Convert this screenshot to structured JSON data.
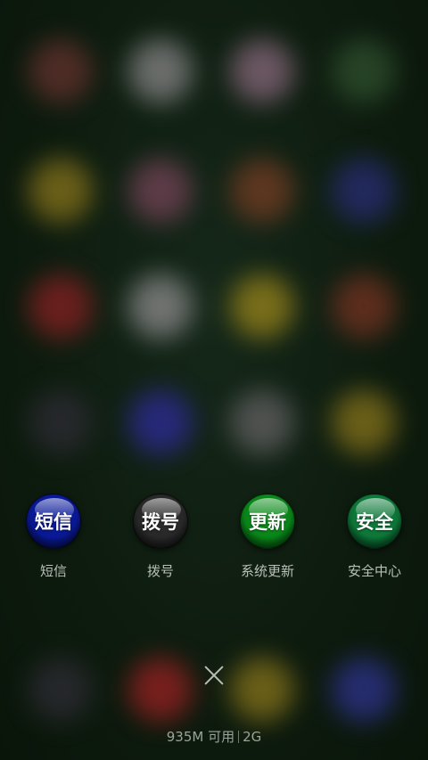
{
  "background_icons": [
    {
      "color": "#5a2f2a"
    },
    {
      "color": "#7a7a7a"
    },
    {
      "color": "#7a6070"
    },
    {
      "color": "#2b4a2b"
    },
    {
      "color": "#7a6a1a"
    },
    {
      "color": "#6a4050"
    },
    {
      "color": "#6a3a22"
    },
    {
      "color": "#252b6a"
    },
    {
      "color": "#7a2020"
    },
    {
      "color": "#808080"
    },
    {
      "color": "#8a7a1a"
    },
    {
      "color": "#6a3020"
    },
    {
      "color": "#2a2a30"
    },
    {
      "color": "#2a2a8a"
    },
    {
      "color": "#5a5a5a"
    },
    {
      "color": "#7a6a1a"
    },
    {
      "color": "#2a2a30"
    },
    {
      "color": "#8a2020"
    },
    {
      "color": "#7a6a1a"
    },
    {
      "color": "#2a3080"
    }
  ],
  "shortcuts": [
    {
      "orb_text": "短信",
      "label": "短信",
      "color": "#0a1a9a"
    },
    {
      "orb_text": "拨号",
      "label": "拨号",
      "color": "#2a2a2a"
    },
    {
      "orb_text": "更新",
      "label": "系统更新",
      "color": "#0a8a1a"
    },
    {
      "orb_text": "安全",
      "label": "安全中心",
      "color": "#0e7a3a"
    }
  ],
  "memory": {
    "available": "935M 可用",
    "network": "2G"
  }
}
